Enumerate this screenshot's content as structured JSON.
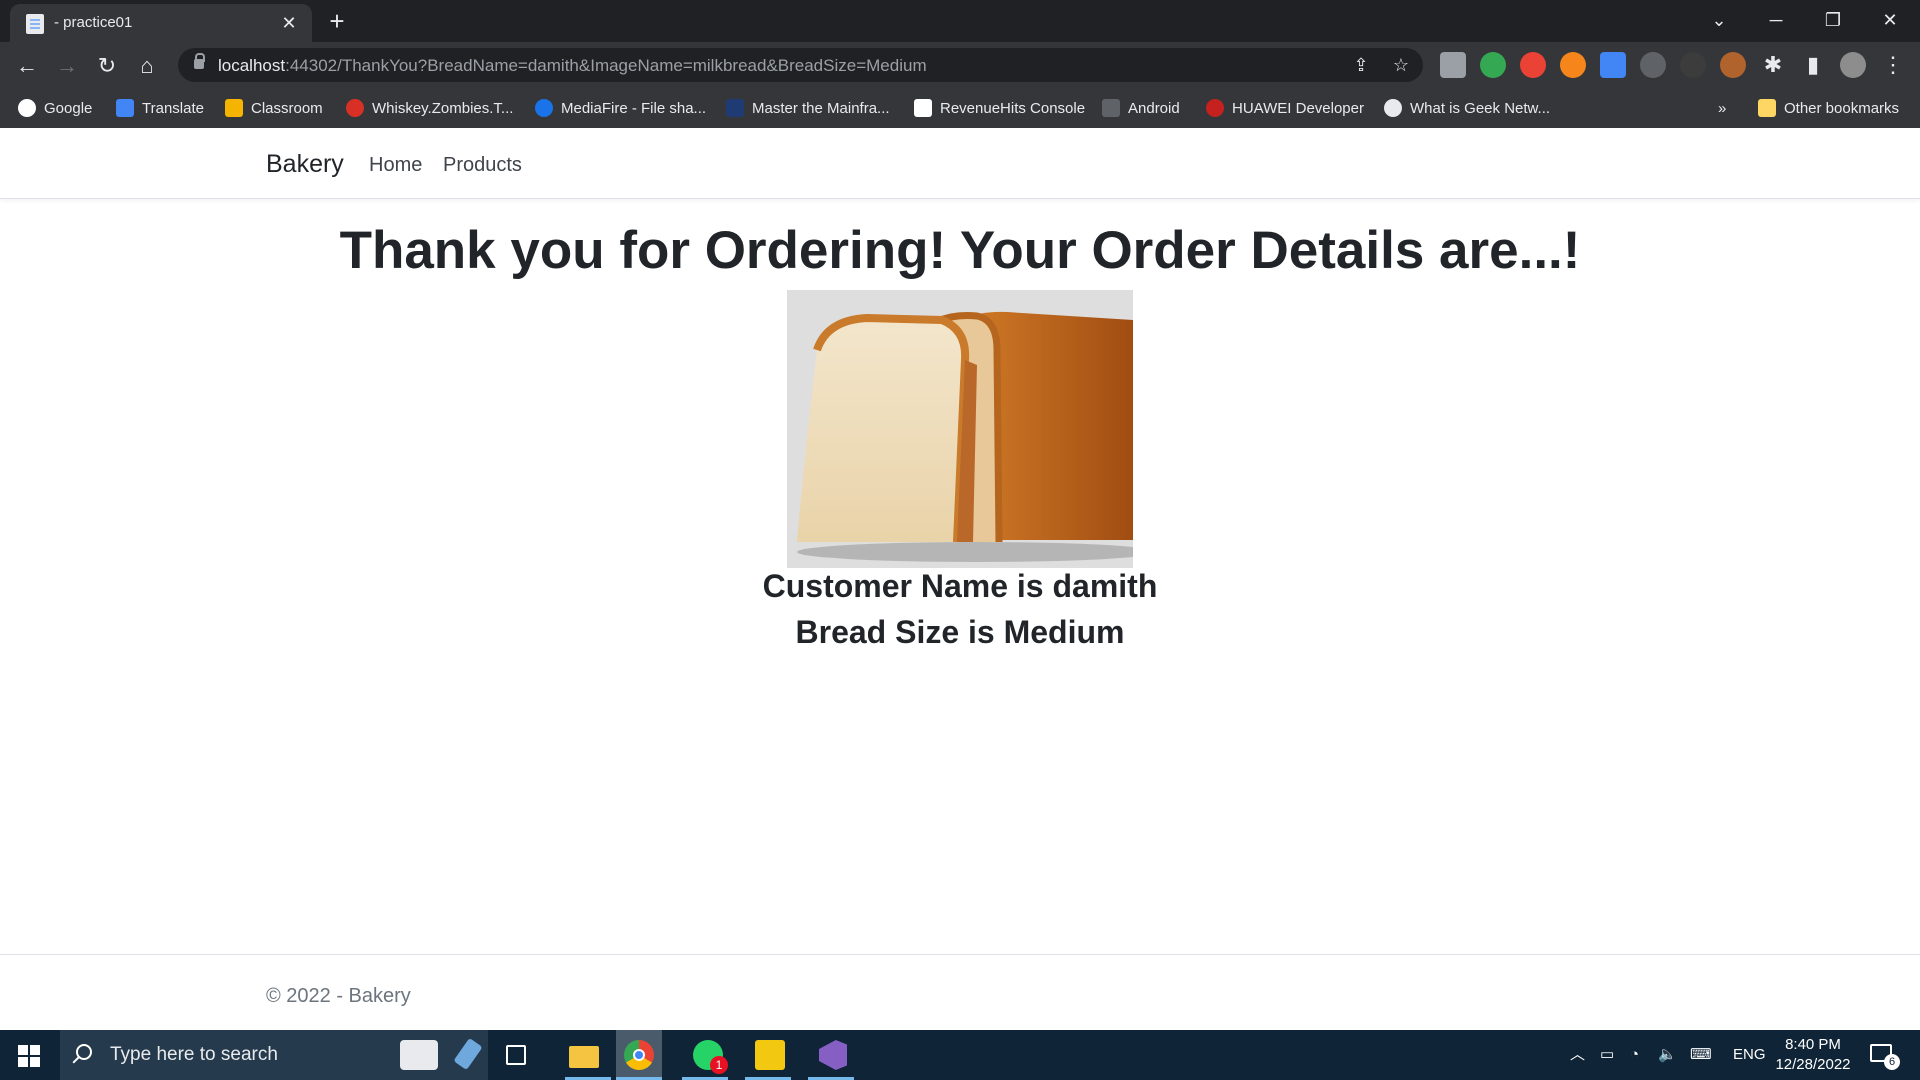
{
  "browser": {
    "tab_title": "- practice01",
    "url_host": "localhost",
    "url_rest": ":44302/ThankYou?BreadName=damith&ImageName=milkbread&BreadSize=Medium",
    "bookmarks": [
      "Google",
      "Translate",
      "Classroom",
      "Whiskey.Zombies.T...",
      "MediaFire - File sha...",
      "Master the Mainfra...",
      "RevenueHits Console",
      "Android",
      "HUAWEI Developer",
      "What is Geek Netw..."
    ],
    "more_bookmarks": "»",
    "other_bookmarks": "Other bookmarks"
  },
  "site": {
    "brand": "Bakery",
    "nav": [
      "Home",
      "Products"
    ],
    "heading": "Thank you for Ordering! Your Order Details are...!",
    "customer_line": "Customer Name is damith",
    "size_line": "Bread Size is Medium",
    "footer": "© 2022 - Bakery"
  },
  "taskbar": {
    "search_placeholder": "Type here to search",
    "language": "ENG",
    "time": "8:40 PM",
    "date": "12/28/2022",
    "whatsapp_badge": "1",
    "notification_count": "6"
  }
}
